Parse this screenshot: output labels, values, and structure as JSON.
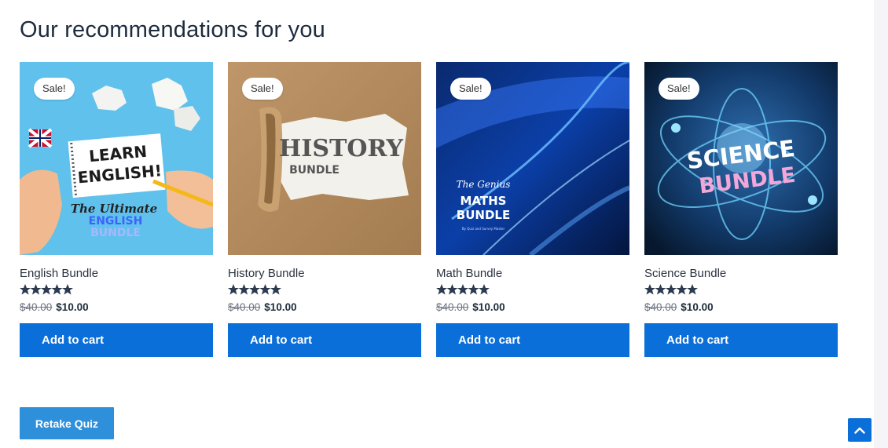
{
  "section": {
    "title": "Our recommendations for you"
  },
  "products": [
    {
      "name": "English Bundle",
      "badge": "Sale!",
      "price_old": "$40.00",
      "price_new": "$10.00",
      "rating": 5,
      "cta": "Add to cart",
      "image_text": [
        "LEARN",
        "ENGLISH!",
        "The Ultimate",
        "ENGLISH",
        "BUNDLE"
      ]
    },
    {
      "name": "History Bundle",
      "badge": "Sale!",
      "price_old": "$40.00",
      "price_new": "$10.00",
      "rating": 5,
      "cta": "Add to cart",
      "image_text": [
        "HISTORY",
        "BUNDLE"
      ]
    },
    {
      "name": "Math Bundle",
      "badge": "Sale!",
      "price_old": "$40.00",
      "price_new": "$10.00",
      "rating": 5,
      "cta": "Add to cart",
      "image_text": [
        "The Genius",
        "MATHS",
        "BUNDLE",
        "By Quiz and Survey Master"
      ]
    },
    {
      "name": "Science Bundle",
      "badge": "Sale!",
      "price_old": "$40.00",
      "price_new": "$10.00",
      "rating": 5,
      "cta": "Add to cart",
      "image_text": [
        "SCIENCE",
        "BUNDLE"
      ]
    }
  ],
  "actions": {
    "retake_label": "Retake Quiz",
    "scroll_top_icon": "chevron-up-icon"
  },
  "colors": {
    "primary": "#0a6fd8",
    "retake": "#2e8fdb",
    "heading": "#1d2c3e",
    "star": "#2b3a4f"
  }
}
